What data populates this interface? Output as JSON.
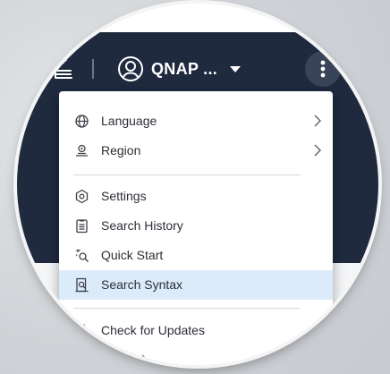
{
  "header": {
    "app_icon": "stack-app-icon",
    "user_icon": "user-circle-icon",
    "username": "QNAP ...",
    "dropdown_icon": "caret-down-icon",
    "more_icon": "vertical-dots-icon"
  },
  "menu": {
    "language": {
      "label": "Language",
      "icon": "globe-icon",
      "submenu_icon": "chevron-right-icon"
    },
    "region": {
      "label": "Region",
      "icon": "map-pin-icon",
      "submenu_icon": "chevron-right-icon"
    },
    "settings": {
      "label": "Settings",
      "icon": "gear-icon"
    },
    "search_history": {
      "label": "Search History",
      "icon": "clipboard-list-icon"
    },
    "quick_start": {
      "label": "Quick Start",
      "icon": "sparkle-search-icon"
    },
    "search_syntax": {
      "label": "Search Syntax",
      "icon": "document-search-icon",
      "highlighted": true
    },
    "check_updates": {
      "label": "Check for Updates",
      "icon": "refresh-icon"
    },
    "report": {
      "label": "Report",
      "icon": "report-icon"
    }
  },
  "colors": {
    "topbar": "#1f2a3f",
    "highlight": "#dcebfa",
    "menu_text": "#2c2f36"
  }
}
